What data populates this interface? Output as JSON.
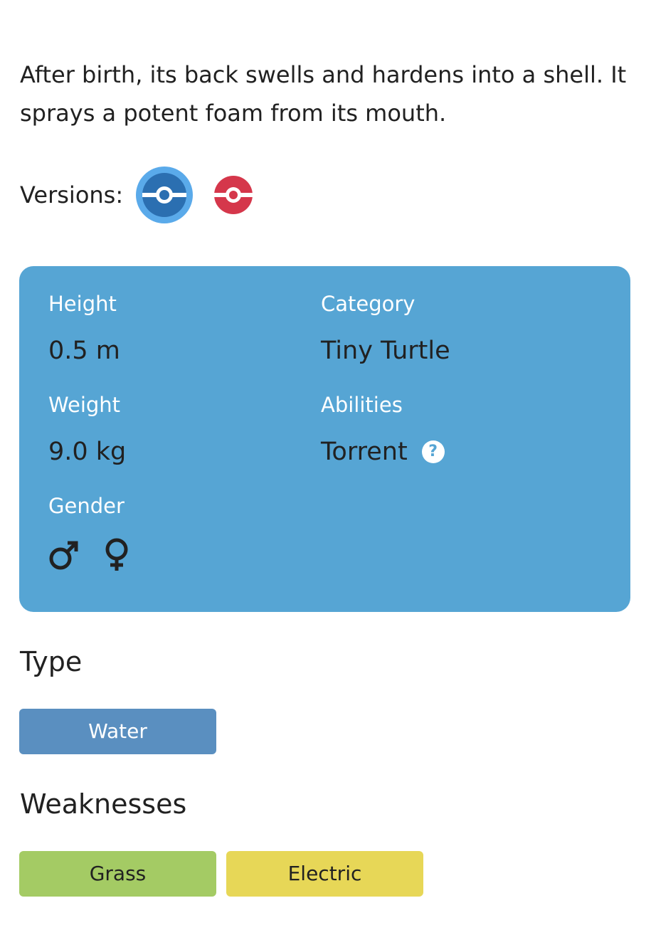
{
  "description": "After birth, its back swells and hardens into a shell. It sprays a potent foam from its mouth.",
  "versions": {
    "label": "Versions:",
    "items": [
      {
        "name": "pokeball-blue-icon",
        "color": "#30a7d7",
        "selected": true
      },
      {
        "name": "pokeball-red-icon",
        "color": "#d5374b",
        "selected": false
      }
    ]
  },
  "info": {
    "background": "#56a5d4",
    "height": {
      "label": "Height",
      "value": "0.5 m"
    },
    "weight": {
      "label": "Weight",
      "value": "9.0 kg"
    },
    "gender": {
      "label": "Gender",
      "icons": [
        "male-icon",
        "female-icon"
      ]
    },
    "category": {
      "label": "Category",
      "value": "Tiny Turtle"
    },
    "abilities": {
      "label": "Abilities",
      "value": "Torrent",
      "help_icon": "question-icon",
      "help_glyph": "?"
    }
  },
  "type": {
    "title": "Type",
    "items": [
      {
        "label": "Water",
        "color": "#5a8fc0",
        "text_color": "#ffffff"
      }
    ]
  },
  "weaknesses": {
    "title": "Weaknesses",
    "items": [
      {
        "label": "Grass",
        "color": "#a4cb64",
        "text_color": "#212121"
      },
      {
        "label": "Electric",
        "color": "#e7d757",
        "text_color": "#212121"
      }
    ]
  }
}
